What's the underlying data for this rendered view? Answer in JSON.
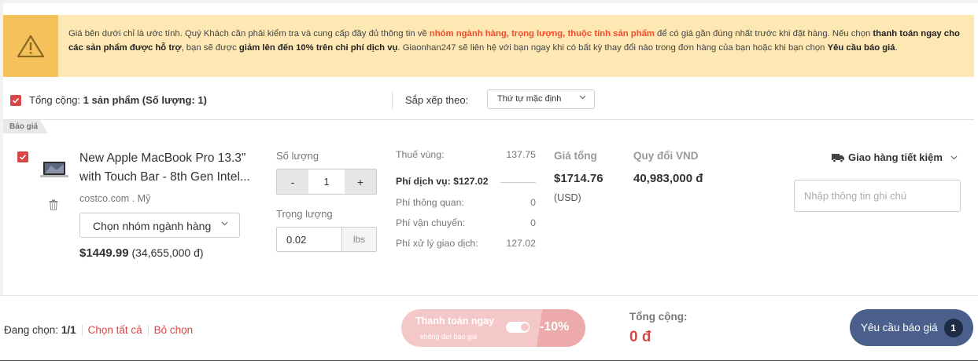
{
  "warning": {
    "t1": "Giá bên dưới chỉ là ước tính. Quý Khách cần phải kiểm tra và cung cấp đầy đủ thông tin về ",
    "hl1": "nhóm ngành hàng, trọng lượng, thuộc tính sản phẩm",
    "t2": " để có giá gần đúng nhất trước khi đặt hàng. Nếu chọn ",
    "b1": "thanh toán ngay cho các sản phẩm được hỗ trợ",
    "t3": ", bạn sẽ được ",
    "b2": "giảm lên đến 10% trên chi phí dịch vụ",
    "t4": ". Giaonhan247 sẽ liên hệ với bạn ngay khi có bất kỳ thay đổi nào trong đơn hàng của bạn hoặc khi bạn chọn ",
    "b3": "Yêu cầu báo giá",
    "t5": "."
  },
  "summary": {
    "label": "Tổng cộng: ",
    "value": "1 sản phẩm (Số lượng: 1)",
    "sort_label": "Sắp xếp theo:",
    "sort_value": "Thứ tự mặc định"
  },
  "section_tag": "Báo giá",
  "product": {
    "name_line1": "New Apple MacBook Pro 13.3\"",
    "name_line2": "with Touch Bar - 8th Gen Intel...",
    "source": "costco.com",
    "source_sep": ".",
    "country": "Mỹ",
    "category_select": "Chọn nhóm ngành hàng",
    "price": "$1449.99",
    "price_vnd": "(34,655,000 đ)"
  },
  "quantity": {
    "label": "Số lượng",
    "minus": "-",
    "value": "1",
    "plus": "+"
  },
  "weight": {
    "label": "Trọng lượng",
    "value": "0.02",
    "unit": "lbs"
  },
  "fees": {
    "vat_label": "Thuế vùng:",
    "vat_value": "137.75",
    "service_label": "Phí dịch vụ:",
    "service_value": "$127.02",
    "customs_label": "Phí thông quan:",
    "customs_value": "0",
    "shipping_label": "Phí vận chuyển:",
    "shipping_value": "0",
    "processing_label": "Phí xử lý giao dịch:",
    "processing_value": "127.02"
  },
  "totals": {
    "label": "Giá tổng",
    "usd": "$1714.76",
    "unit": "(USD)",
    "vnd_label": "Quy đổi VND",
    "vnd": "40,983,000 đ"
  },
  "shipping": {
    "method": "Giao hàng tiết kiệm",
    "note_placeholder": "Nhập thông tin ghi chú"
  },
  "footer": {
    "selecting_label": "Đang chọn:",
    "selecting_value": "1/1",
    "select_all": "Chọn tất cả",
    "deselect": "Bỏ chọn",
    "pay_now": "Thanh toán ngay",
    "pay_now_sub": "không đợi báo giá",
    "discount": "-10%",
    "total_label": "Tổng cộng:",
    "total_value": "0 đ",
    "request_quote": "Yêu cầu báo giá",
    "request_count": "1"
  },
  "colors": {
    "accent_red": "#d94646",
    "warning_bg": "#fde8b4",
    "warning_icon_bg": "#f5c15a",
    "primary_button": "#4a5f8c"
  }
}
